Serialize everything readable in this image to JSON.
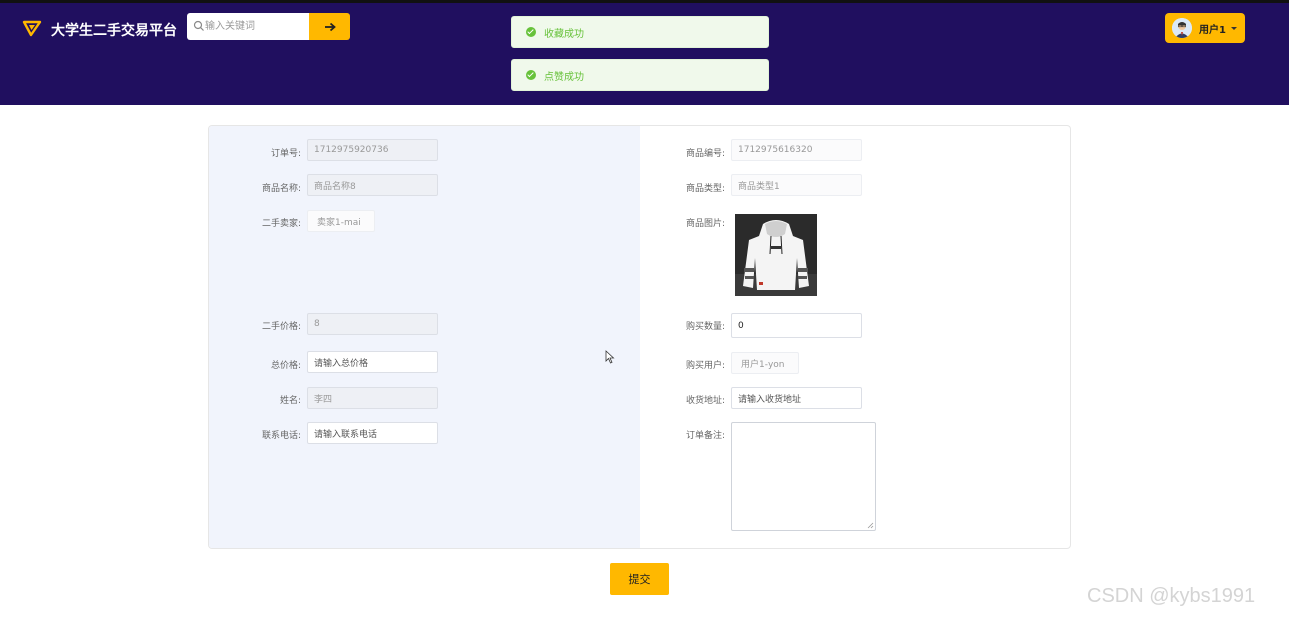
{
  "header": {
    "brand": "大学生二手交易平台",
    "search_placeholder": "输入关键词",
    "user_name": "用户1"
  },
  "toasts": [
    "收藏成功",
    "点赞成功"
  ],
  "form": {
    "order_no_label": "订单号:",
    "order_no_value": "1712975920736",
    "product_name_label": "商品名称:",
    "product_name_value": "商品名称8",
    "seller_label": "二手卖家:",
    "seller_value": "卖家1-mai",
    "price_label": "二手价格:",
    "price_value": "8",
    "total_label": "总价格:",
    "total_placeholder": "请输入总价格",
    "name_label": "姓名:",
    "name_value": "李四",
    "phone_label": "联系电话:",
    "phone_placeholder": "请输入联系电话",
    "product_id_label": "商品编号:",
    "product_id_value": "1712975616320",
    "product_type_label": "商品类型:",
    "product_type_value": "商品类型1",
    "product_image_label": "商品图片:",
    "qty_label": "购买数量:",
    "qty_value": "0",
    "buyer_label": "购买用户:",
    "buyer_value": "用户1-yon",
    "address_label": "收货地址:",
    "address_placeholder": "请输入收货地址",
    "remark_label": "订单备注:"
  },
  "submit_label": "提交",
  "watermark": "CSDN @kybs1991",
  "colors": {
    "header_bg": "#200f5f",
    "accent": "#ffb800",
    "success": "#67c23a"
  }
}
